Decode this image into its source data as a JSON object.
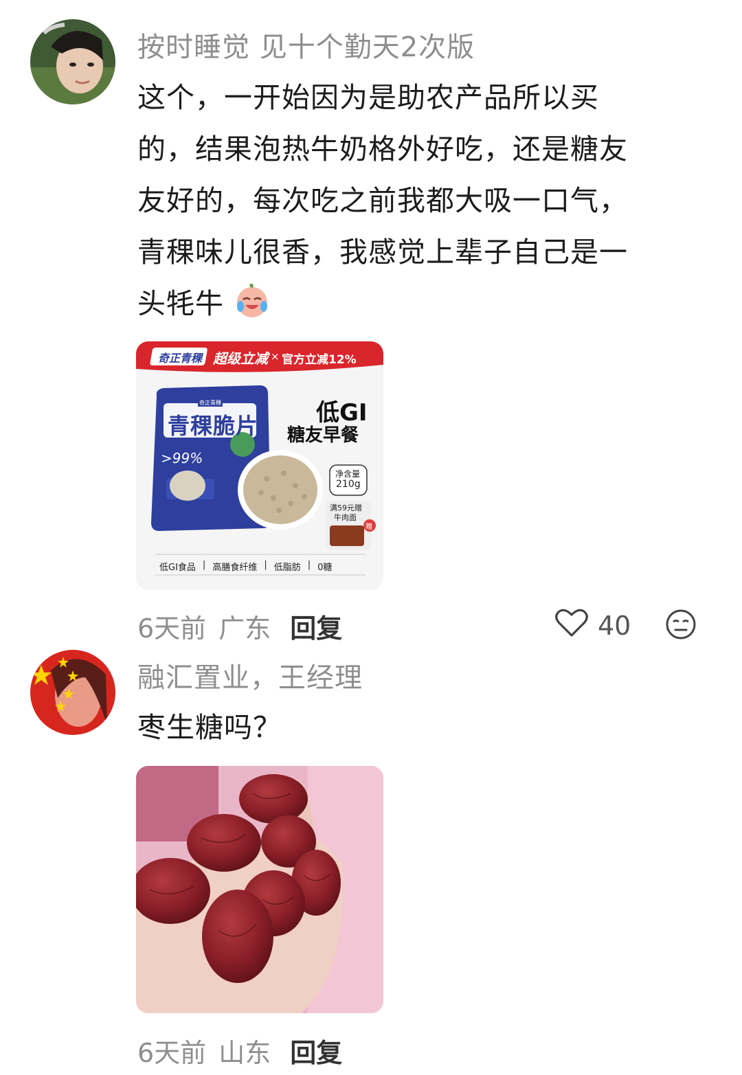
{
  "comments": [
    {
      "username": "按时睡觉 见十个勤天2次版",
      "text_lines": [
        "这个，一开始因为是助农产品所以买",
        "的，结果泡热牛奶格外好吃，还是糖友",
        "友好的，每次吃之前我都大吸一口气，",
        "青稞味儿很香，我感觉上辈子自己是一",
        "头牦牛"
      ],
      "emoji": "crying-laugh-emoji",
      "time": "6天前",
      "location": "广东",
      "reply_label": "回复",
      "likes": "40",
      "image": {
        "banner_brand": "奇正青稞",
        "banner_promo": "超级立减",
        "banner_x": "×",
        "banner_official": "官方立减12%",
        "package_title": "青稞脆片",
        "package_small_brand": "奇正青稞",
        "package_percent": ">99%",
        "headline_big": "低GI",
        "headline_small": "糖友早餐",
        "net_weight_label": "净含量",
        "net_weight_value": "210g",
        "gift_text_1": "满59元赠",
        "gift_text_2": "牛肉面",
        "gift_badge": "赠",
        "features": [
          "低GI食品",
          "高膳食纤维",
          "低脂肪",
          "0糖"
        ]
      }
    },
    {
      "username": "融汇置业，王经理",
      "text_lines": [
        "枣生糖吗？"
      ],
      "time": "6天前",
      "location": "山东",
      "reply_label": "回复"
    }
  ],
  "colors": {
    "banner_red": "#d8262c",
    "package_blue": "#2e3f9e",
    "date_red": "#7a1a1f",
    "meta_gray": "#8e8e8e"
  }
}
